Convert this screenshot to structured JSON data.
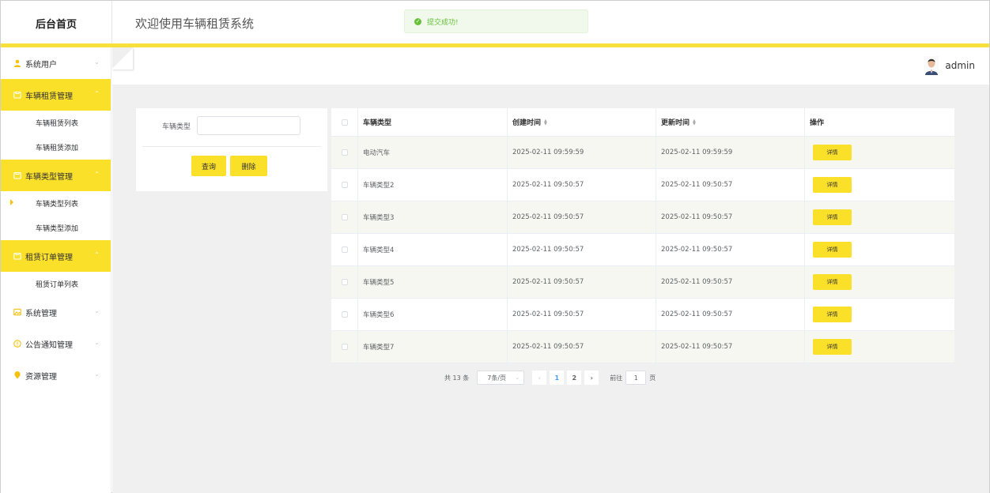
{
  "app": {
    "logo_title": "后台首页",
    "system_title": "欢迎使用车辆租赁系统",
    "accent_color": "#fbe02a"
  },
  "toast": {
    "message": "提交成功!",
    "type": "success",
    "color": "#67c23a"
  },
  "user": {
    "name": "admin"
  },
  "sidebar": {
    "items": [
      {
        "label": "系统用户",
        "icon": "user-icon",
        "expanded": false,
        "active": false,
        "children": []
      },
      {
        "label": "车辆租赁管理",
        "icon": "folder-icon",
        "expanded": true,
        "active": true,
        "children": [
          {
            "label": "车辆租赁列表"
          },
          {
            "label": "车辆租赁添加"
          }
        ]
      },
      {
        "label": "车辆类型管理",
        "icon": "folder-icon",
        "expanded": true,
        "active": true,
        "children": [
          {
            "label": "车辆类型列表",
            "current": true
          },
          {
            "label": "车辆类型添加"
          }
        ]
      },
      {
        "label": "租赁订单管理",
        "icon": "folder-icon",
        "expanded": true,
        "active": true,
        "children": [
          {
            "label": "租赁订单列表"
          }
        ]
      },
      {
        "label": "系统管理",
        "icon": "picture-icon",
        "expanded": false,
        "active": false,
        "children": []
      },
      {
        "label": "公告通知管理",
        "icon": "info-circle-icon",
        "expanded": false,
        "active": false,
        "children": []
      },
      {
        "label": "资源管理",
        "icon": "location-pin-icon",
        "expanded": false,
        "active": false,
        "children": []
      }
    ]
  },
  "search": {
    "field_label": "车辆类型",
    "field_value": "",
    "field_placeholder": "",
    "query_label": "查询",
    "delete_label": "删除"
  },
  "table": {
    "columns": [
      "车辆类型",
      "创建时间",
      "更新时间",
      "操作"
    ],
    "detail_label": "详情",
    "rows": [
      {
        "type": "电动汽车",
        "created": "2025-02-11 09:59:59",
        "updated": "2025-02-11 09:59:59"
      },
      {
        "type": "车辆类型2",
        "created": "2025-02-11 09:50:57",
        "updated": "2025-02-11 09:50:57"
      },
      {
        "type": "车辆类型3",
        "created": "2025-02-11 09:50:57",
        "updated": "2025-02-11 09:50:57"
      },
      {
        "type": "车辆类型4",
        "created": "2025-02-11 09:50:57",
        "updated": "2025-02-11 09:50:57"
      },
      {
        "type": "车辆类型5",
        "created": "2025-02-11 09:50:57",
        "updated": "2025-02-11 09:50:57"
      },
      {
        "type": "车辆类型6",
        "created": "2025-02-11 09:50:57",
        "updated": "2025-02-11 09:50:57"
      },
      {
        "type": "车辆类型7",
        "created": "2025-02-11 09:50:57",
        "updated": "2025-02-11 09:50:57"
      }
    ]
  },
  "pagination": {
    "total_text": "共 13 条",
    "page_size_text": "7条/页",
    "pages": [
      "1",
      "2"
    ],
    "current_page": "1",
    "goto_label": "前往",
    "jump_value": "1",
    "page_suffix": "页"
  }
}
